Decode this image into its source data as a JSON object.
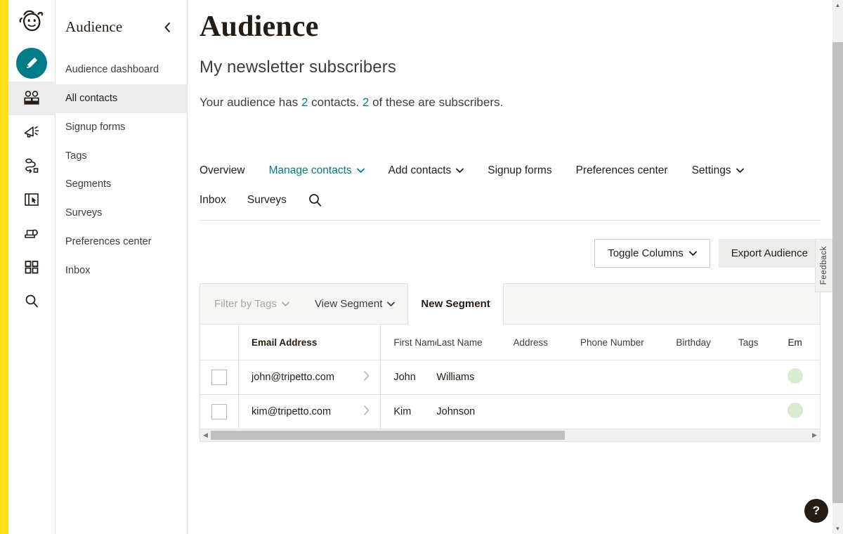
{
  "brand": {
    "accent_teal": "#007C89",
    "accent_yellow": "#FFE01B",
    "ink": "#241c15",
    "logo_name": "mailchimp-freddie-logo"
  },
  "icon_rail": {
    "create_label": "Create",
    "items": [
      {
        "name": "audience-icon",
        "label": "Audience",
        "active": true
      },
      {
        "name": "campaigns-megaphone-icon",
        "label": "Campaigns",
        "active": false
      },
      {
        "name": "automations-journey-icon",
        "label": "Automations",
        "active": false
      },
      {
        "name": "website-icon",
        "label": "Website",
        "active": false
      },
      {
        "name": "content-studio-icon",
        "label": "Content Studio",
        "active": false
      },
      {
        "name": "integrations-grid-icon",
        "label": "Integrations",
        "active": false
      },
      {
        "name": "search-icon",
        "label": "Search",
        "active": false
      }
    ]
  },
  "sidebar": {
    "title": "Audience",
    "collapse_icon": "chevron-left-icon",
    "items": [
      {
        "label": "Audience dashboard",
        "active": false
      },
      {
        "label": "All contacts",
        "active": true
      },
      {
        "label": "Signup forms",
        "active": false
      },
      {
        "label": "Tags",
        "active": false
      },
      {
        "label": "Segments",
        "active": false
      },
      {
        "label": "Surveys",
        "active": false
      },
      {
        "label": "Preferences center",
        "active": false
      },
      {
        "label": "Inbox",
        "active": false
      }
    ]
  },
  "page": {
    "title": "Audience",
    "subtitle": "My newsletter subscribers",
    "summary_prefix": "Your audience has ",
    "contacts_count": "2",
    "summary_middle": " contacts. ",
    "subscribers_count": "2",
    "summary_suffix": " of these are subscribers."
  },
  "tabs": [
    {
      "label": "Overview",
      "active": false,
      "has_chevron": false
    },
    {
      "label": "Manage contacts",
      "active": true,
      "has_chevron": true
    },
    {
      "label": "Add contacts",
      "active": false,
      "has_chevron": true
    },
    {
      "label": "Signup forms",
      "active": false,
      "has_chevron": false
    },
    {
      "label": "Preferences center",
      "active": false,
      "has_chevron": false
    },
    {
      "label": "Settings",
      "active": false,
      "has_chevron": true
    }
  ],
  "subtabs": {
    "items": [
      {
        "label": "Inbox"
      },
      {
        "label": "Surveys"
      }
    ],
    "search_icon": "search-icon"
  },
  "actions": {
    "toggle_columns_label": "Toggle Columns",
    "export_audience_label": "Export Audience"
  },
  "filter_bar": {
    "filter_by_tags_label": "Filter by Tags",
    "view_segment_label": "View Segment",
    "new_segment_label": "New Segment"
  },
  "table": {
    "columns": [
      "Email Address",
      "First Name",
      "Last Name",
      "Address",
      "Phone Number",
      "Birthday",
      "Tags",
      "Em"
    ],
    "rows": [
      {
        "email": "john@tripetto.com",
        "first_name": "John",
        "last_name": "Williams",
        "address": "",
        "phone": "",
        "birthday": "",
        "tags": "",
        "status": "subscribed"
      },
      {
        "email": "kim@tripetto.com",
        "first_name": "Kim",
        "last_name": "Johnson",
        "address": "",
        "phone": "",
        "birthday": "",
        "tags": "",
        "status": "subscribed"
      }
    ]
  },
  "feedback": {
    "label": "Feedback"
  },
  "help": {
    "label": "?"
  }
}
